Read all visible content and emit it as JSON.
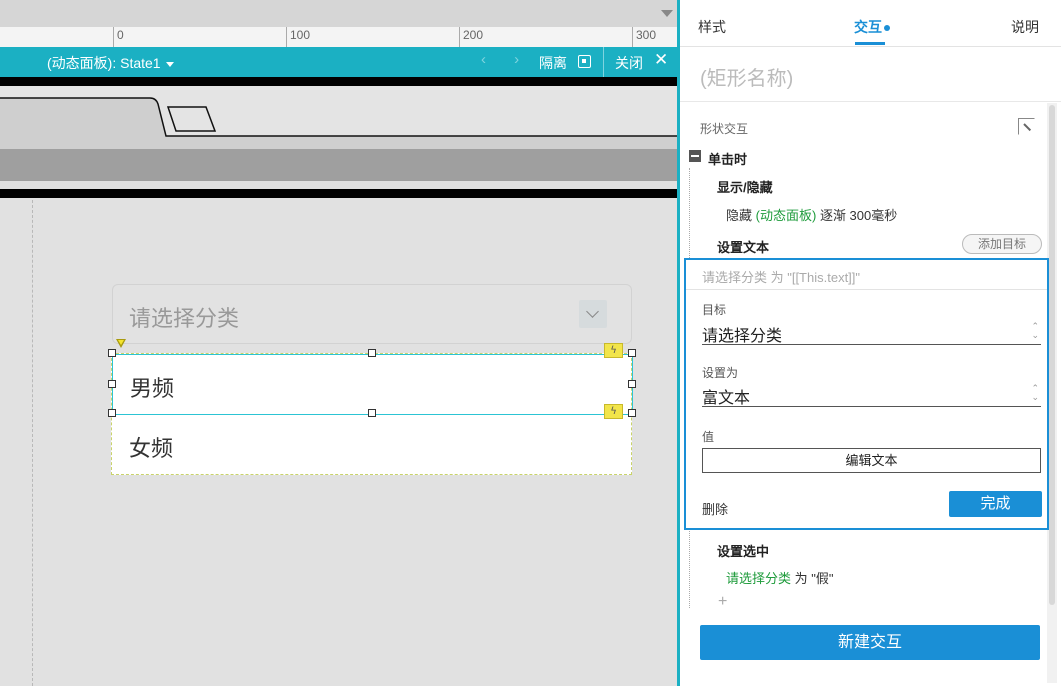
{
  "ruler": {
    "labels": [
      "0",
      "100",
      "200",
      "300"
    ]
  },
  "state_bar": {
    "title": "(动态面板): State1",
    "isolate_label": "隔离",
    "close_label": "关闭",
    "nav_arrows": "‹ ›",
    "close_x": "✕"
  },
  "canvas": {
    "dropdown_placeholder": "请选择分类",
    "options": [
      "男频",
      "女频"
    ],
    "bolt_glyph": "ϟ"
  },
  "panel": {
    "tabs": {
      "style": "样式",
      "interaction": "交互",
      "notes": "说明"
    },
    "shape_name": "(矩形名称)",
    "section_label": "形状交互",
    "event": "单击时",
    "actions": {
      "show_hide_title": "显示/隐藏",
      "show_hide_desc": {
        "verb": "隐藏",
        "target": "(动态面板)",
        "rest": "逐渐 300毫秒"
      },
      "set_text_title": "设置文本",
      "add_target": "添加目标",
      "set_selected_title": "设置选中",
      "set_selected_desc": {
        "target": "请选择分类",
        "rest": "为 \"假\""
      }
    },
    "editor": {
      "summary": "请选择分类 为 \"[[This.text]]\"",
      "target_label": "目标",
      "target_value": "请选择分类",
      "set_as_label": "设置为",
      "set_as_value": "富文本",
      "value_label": "值",
      "edit_text_button": "编辑文本",
      "delete": "删除",
      "done": "完成"
    },
    "add_plus": "+",
    "new_interaction": "新建交互"
  },
  "colors": {
    "teal": "#1bb0c3",
    "blue": "#1a8fd6",
    "green": "#1e9b3b",
    "bolt_yellow": "#f2e54a"
  }
}
